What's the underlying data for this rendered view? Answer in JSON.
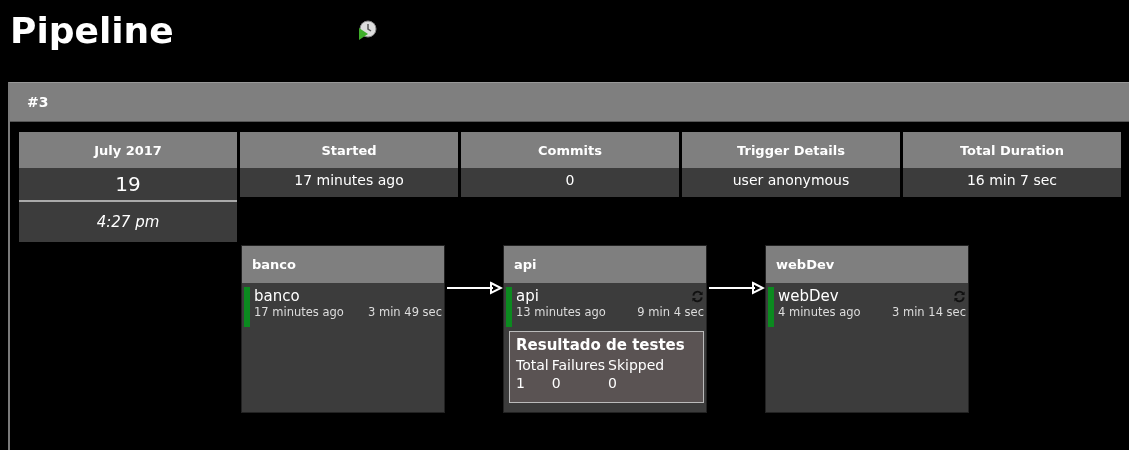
{
  "page": {
    "title": "Pipeline"
  },
  "run": {
    "title": "#3",
    "date": {
      "month": "July 2017",
      "day": "19",
      "time": "4:27 pm"
    },
    "info": [
      {
        "label": "Started",
        "value": "17 minutes ago"
      },
      {
        "label": "Commits",
        "value": "0"
      },
      {
        "label": "Trigger Details",
        "value": "user anonymous"
      },
      {
        "label": "Total Duration",
        "value": "16 min 7 sec"
      }
    ],
    "stages": [
      {
        "title": "banco",
        "job": "banco",
        "color": "#0b8a1f",
        "ago": "17 minutes ago",
        "duration": "3 min 49 sec",
        "retry": false
      },
      {
        "title": "api",
        "job": "api",
        "color": "#0b8a1f",
        "ago": "13 minutes ago",
        "duration": "9 min 4 sec",
        "retry": true,
        "tests": {
          "title": "Resultado de testes",
          "columns": [
            "Total",
            "Failures",
            "Skipped"
          ],
          "values": [
            "1",
            "0",
            "0"
          ]
        }
      },
      {
        "title": "webDev",
        "job": "webDev",
        "color": "#0b8a1f",
        "ago": "4 minutes ago",
        "duration": "3 min 14 sec",
        "retry": true
      }
    ]
  }
}
